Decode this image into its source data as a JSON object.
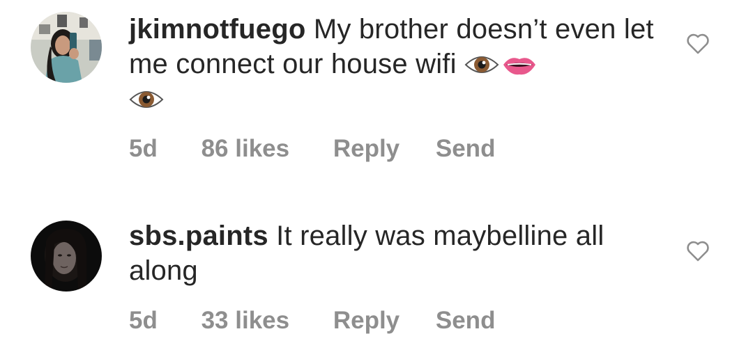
{
  "comments": [
    {
      "username": "jkimnotfuego",
      "text": "My brother doesn’t even let me connect our house wifi",
      "emojis": [
        "eye-emoji",
        "lips-emoji",
        "eye-emoji"
      ],
      "time": "5d",
      "likes": "86 likes",
      "reply_label": "Reply",
      "send_label": "Send",
      "like_icon": "heart-outline-icon"
    },
    {
      "username": "sbs.paints",
      "text": "It really was maybelline all along",
      "emojis": [],
      "time": "5d",
      "likes": "33 likes",
      "reply_label": "Reply",
      "send_label": "Send",
      "like_icon": "heart-outline-icon"
    }
  ],
  "colors": {
    "primary_text": "#262626",
    "secondary_text": "#8e8e8e",
    "background": "#ffffff"
  }
}
